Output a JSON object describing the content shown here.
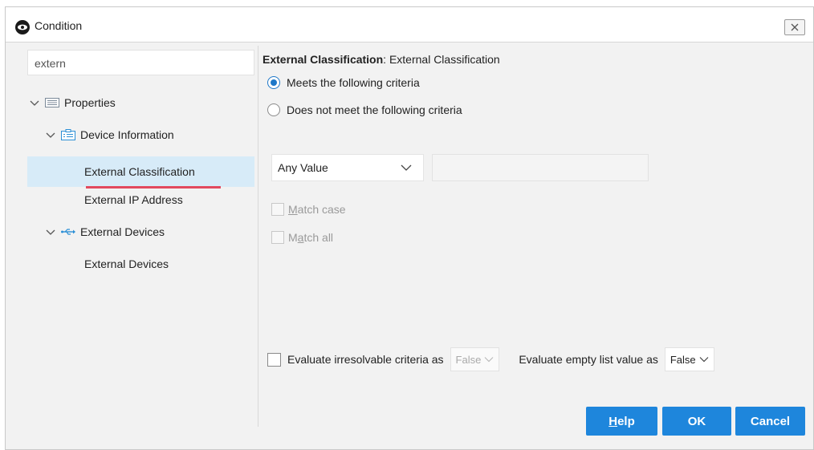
{
  "window": {
    "title": "Condition"
  },
  "search": {
    "value": "extern"
  },
  "tree": {
    "root_label": "Properties",
    "group1_label": "Device Information",
    "item1_label": "External Classification",
    "item2_label": "External IP Address",
    "group2_label": "External Devices",
    "item3_label": "External Devices"
  },
  "panel": {
    "heading_bold": "External Classification",
    "heading_rest": ": External Classification",
    "radio_meets": "Meets the following criteria",
    "radio_not_meets": "Does not meet the following criteria",
    "select_value": "Any Value",
    "match_case_accel": "M",
    "match_case_rest": "atch case",
    "match_all_pre": "M",
    "match_all_accel": "a",
    "match_all_rest": "tch all",
    "eval_irresolvable_label": "Evaluate irresolvable criteria as",
    "eval_irresolvable_value": "False",
    "eval_empty_label": "Evaluate empty list value as",
    "eval_empty_value": "False"
  },
  "buttons": {
    "help_accel": "H",
    "help_rest": "elp",
    "ok": "OK",
    "cancel": "Cancel"
  },
  "colors": {
    "accent": "#1e86dc",
    "selection": "#d7ebf8",
    "underline": "#e24a5f"
  },
  "icons": [
    "condition-eye-icon",
    "close-icon",
    "chevron-down-icon",
    "properties-list-icon",
    "device-info-icon",
    "usb-devices-icon"
  ]
}
